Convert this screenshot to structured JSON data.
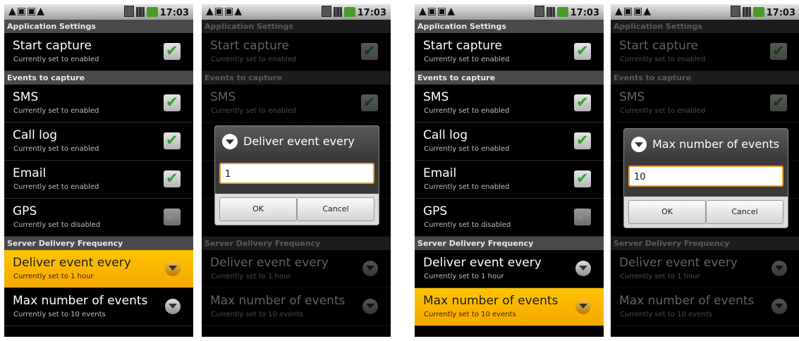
{
  "status": {
    "left_icons": "▲▣▣▲",
    "time": "17:03"
  },
  "screens": [
    {
      "header": "Application Settings",
      "start_capture": {
        "title": "Start capture",
        "sub": "Currently set to enabled"
      },
      "events_header": "Events to capture",
      "sms": {
        "title": "SMS",
        "sub": "Currently set to enabled"
      },
      "calllog": {
        "title": "Call log",
        "sub": "Currently set to enabled"
      },
      "email": {
        "title": "Email",
        "sub": "Currently set to enabled"
      },
      "gps": {
        "title": "GPS",
        "sub": "Currently set to disabled"
      },
      "server_header": "Server Delivery Frequency",
      "deliver": {
        "title": "Deliver event every",
        "sub": "Currently set to 1 hour"
      },
      "maxevents": {
        "title": "Max number of events",
        "sub": "Currently set to 10 events"
      }
    }
  ],
  "dialog_deliver": {
    "title": "Deliver event every",
    "value": "1",
    "ok": "OK",
    "cancel": "Cancel"
  },
  "dialog_max": {
    "title": "Max number of events",
    "value": "10",
    "ok": "OK",
    "cancel": "Cancel"
  }
}
